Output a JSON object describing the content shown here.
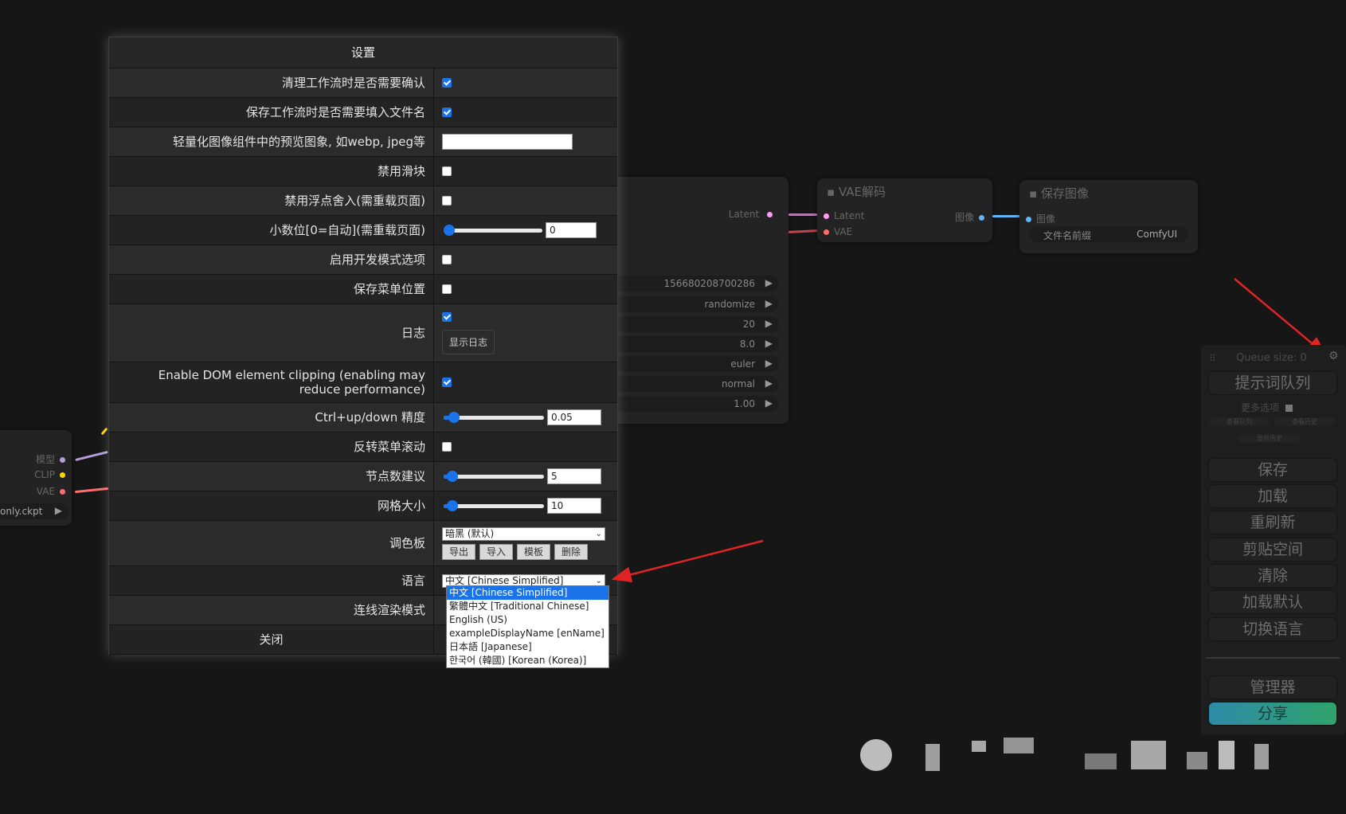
{
  "dialog": {
    "title": "设置",
    "rows": [
      {
        "label": "清理工作流时是否需要确认",
        "checked": true
      },
      {
        "label": "保存工作流时是否需要填入文件名",
        "checked": true
      },
      {
        "label": "轻量化图像组件中的预览图象, 如webp, jpeg等",
        "value": ""
      },
      {
        "label": "禁用滑块",
        "checked": false
      },
      {
        "label": "禁用浮点舍入(需重载页面)",
        "checked": false
      },
      {
        "label": "小数位[0=自动](需重载页面)",
        "value": "0",
        "slider": 0.0
      },
      {
        "label": "启用开发模式选项",
        "checked": false
      },
      {
        "label": "保存菜单位置",
        "checked": false
      },
      {
        "label": "日志",
        "checked": true,
        "button": "显示日志"
      },
      {
        "label": "Enable DOM element clipping (enabling may reduce performance)",
        "checked": true
      },
      {
        "label": "Ctrl+up/down 精度",
        "value": "0.05",
        "slider": 0.05
      },
      {
        "label": "反转菜单滚动",
        "checked": false
      },
      {
        "label": "节点数建议",
        "value": "5",
        "slider": 0.03
      },
      {
        "label": "网格大小",
        "value": "10",
        "slider": 0.03
      },
      {
        "label": "调色板",
        "selected": "暗黑 (默认)",
        "buttons": [
          "导出",
          "导入",
          "模板",
          "删除"
        ]
      },
      {
        "label": "语言",
        "selected": "中文 [Chinese Simplified]"
      },
      {
        "label": "连线渲染模式"
      }
    ],
    "close_label": "关闭"
  },
  "language_options": [
    "中文 [Chinese Simplified]",
    "繁體中文 [Traditional Chinese]",
    "English (US)",
    "exampleDisplayName [enName]",
    "日本語 [Japanese]",
    "한국어 (韓國) [Korean (Korea)]"
  ],
  "nodes": {
    "vae_decode": {
      "title": "VAE解码",
      "inputs": [
        "Latent",
        "VAE"
      ],
      "output": "图像"
    },
    "save_image": {
      "title": "保存图像",
      "input": "图像",
      "prefix_label": "文件名前缀",
      "prefix_value": "ComfyUI"
    },
    "sampler_output": "Latent",
    "sampler_widgets": [
      "156680208700286",
      "randomize",
      "20",
      "8.0",
      "euler",
      "normal",
      "1.00"
    ],
    "loader_slots": [
      "模型",
      "CLIP",
      "VAE"
    ],
    "loader_widget": "only.ckpt"
  },
  "menu": {
    "queue_size": "Queue size: 0",
    "queue_prompt": "提示词队列",
    "extra_options": "更多选项",
    "small_buttons": [
      "查看队列",
      "查看历史",
      "显示历史"
    ],
    "buttons": [
      "保存",
      "加载",
      "重刷新",
      "剪贴空间",
      "清除",
      "加载默认",
      "切换语言"
    ],
    "manager": "管理器",
    "share": "分享"
  },
  "colors": {
    "accent": "#1a73e8",
    "annotation_arrow": "#e02424",
    "share_gradient_start": "#2e8aa8",
    "share_gradient_end": "#2fa36b"
  }
}
